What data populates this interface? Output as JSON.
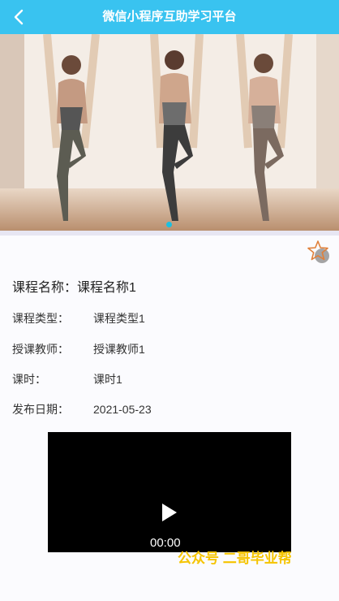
{
  "header": {
    "title": "微信小程序互助学习平台"
  },
  "banner": {
    "slide_count": 1,
    "active_slide": 1
  },
  "course": {
    "name_label": "课程名称：",
    "name": "课程名称1",
    "fields": [
      {
        "label": "课程类型：",
        "value": "课程类型1"
      },
      {
        "label": "授课教师：",
        "value": "授课教师1"
      },
      {
        "label": "课时：",
        "value": "课时1"
      },
      {
        "label": "发布日期：",
        "value": "2021-05-23"
      }
    ]
  },
  "video": {
    "time": "00:00"
  },
  "watermark": {
    "text": "公众号 二哥毕业帮"
  },
  "colors": {
    "header_bg": "#39c3f0",
    "dot": "#1cc0e0",
    "watermark": "#f5c400"
  }
}
